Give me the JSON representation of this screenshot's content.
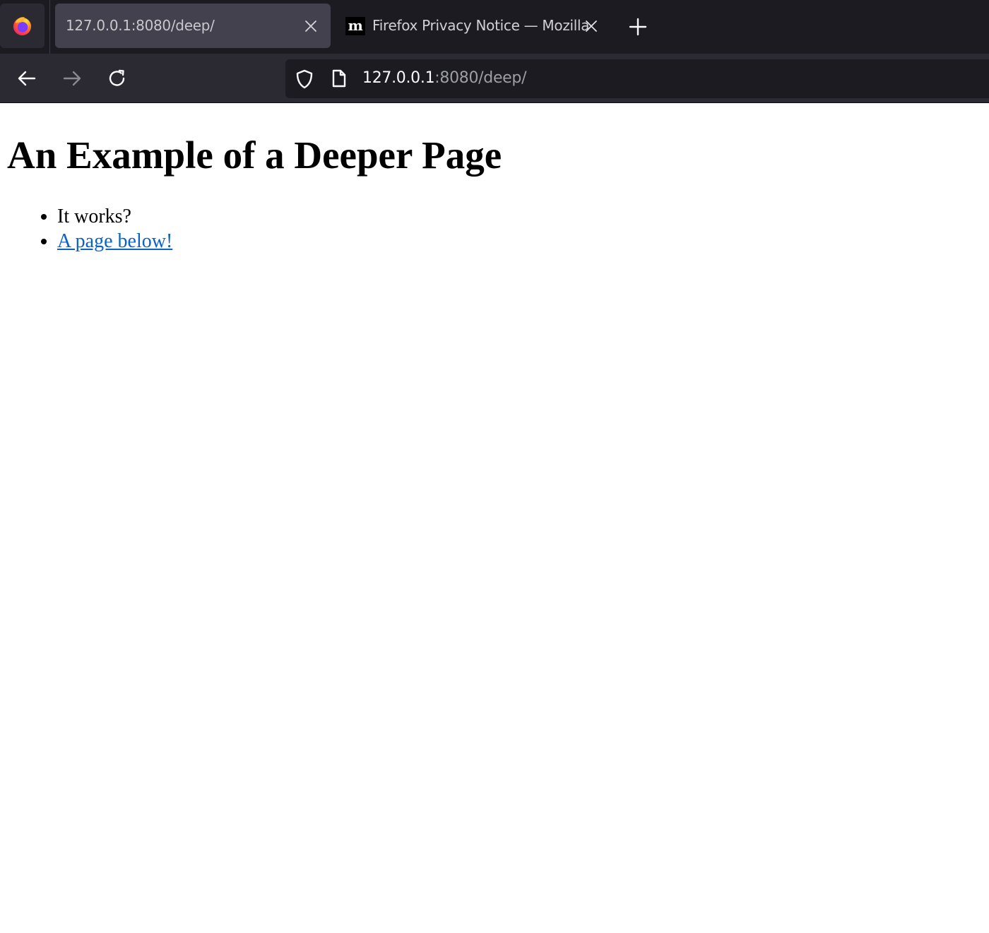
{
  "browser": {
    "menu_icon": "firefox-logo-icon",
    "tabs": [
      {
        "title": "127.0.0.1:8080/deep/",
        "active": true,
        "favicon": "none"
      },
      {
        "title": "Firefox Privacy Notice — Mozilla",
        "active": false,
        "favicon": "m"
      }
    ],
    "new_tab_icon": "plus-icon",
    "nav": {
      "back_icon": "arrow-left-icon",
      "forward_icon": "arrow-right-icon",
      "reload_icon": "reload-icon"
    },
    "urlbar": {
      "security_icon": "shield-icon",
      "page_icon": "page-icon",
      "host": "127.0.0.1",
      "rest": ":8080/deep/"
    }
  },
  "page": {
    "title": "An Example of a Deeper Page",
    "items": [
      {
        "text": "It works?",
        "link": false
      },
      {
        "text": "A page below!",
        "link": true
      }
    ]
  },
  "colors": {
    "tab_strip": "#1c1b22",
    "active_tab": "#42414d",
    "toolbar": "#2b2a33",
    "urlbar": "#1c1b22",
    "link": "#0b63c5"
  }
}
